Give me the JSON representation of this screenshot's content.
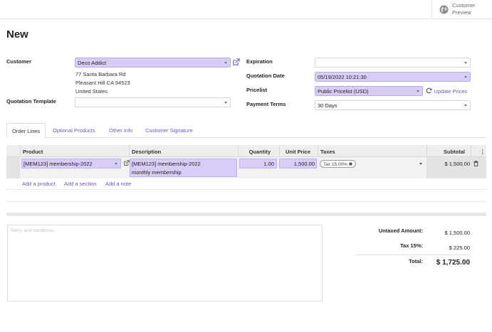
{
  "topbar": {
    "preview_line1": "Customer",
    "preview_line2": "Preview"
  },
  "page": {
    "title": "New"
  },
  "form": {
    "customer": {
      "label": "Customer",
      "value": "Deco Addict",
      "address": [
        "77 Santa Barbara Rd",
        "Pleasant Hill CA 94523",
        "United States"
      ]
    },
    "quotation_template": {
      "label": "Quotation Template",
      "value": ""
    },
    "expiration": {
      "label": "Expiration",
      "value": ""
    },
    "quotation_date": {
      "label": "Quotation Date",
      "value": "05/19/2022 10:21:30"
    },
    "pricelist": {
      "label": "Pricelist",
      "value": "Public Pricelist (USD)",
      "update_label": "Update Prices"
    },
    "payment_terms": {
      "label": "Payment Terms",
      "value": "30 Days"
    }
  },
  "tabs": [
    {
      "label": "Order Lines",
      "active": true
    },
    {
      "label": "Optional Products",
      "active": false
    },
    {
      "label": "Other Info",
      "active": false
    },
    {
      "label": "Customer Signature",
      "active": false
    }
  ],
  "table": {
    "headers": {
      "product": "Product",
      "description": "Description",
      "quantity": "Quantity",
      "unit_price": "Unit Price",
      "taxes": "Taxes",
      "subtotal": "Subtotal"
    },
    "row": {
      "product": "[MEM123] membership-2022",
      "description_line1": "[MEM123] membership-2022",
      "description_line2": "monthly membership",
      "quantity": "1.00",
      "unit_price": "1,500.00",
      "tax": "Tax 15.00%",
      "subtotal": "$ 1,500.00"
    },
    "actions": {
      "add_product": "Add a product",
      "add_section": "Add a section",
      "add_note": "Add a note"
    }
  },
  "terms": {
    "placeholder": "Terms and conditions..."
  },
  "totals": {
    "untaxed_label": "Untaxed Amount:",
    "untaxed_value": "$ 1,500.00",
    "tax_label": "Tax 15%:",
    "tax_value": "$ 225.00",
    "total_label": "Total:",
    "total_value": "$ 1,725.00"
  },
  "colors": {
    "accent": "#6f57b5",
    "highlight": "#d8cdf6"
  }
}
